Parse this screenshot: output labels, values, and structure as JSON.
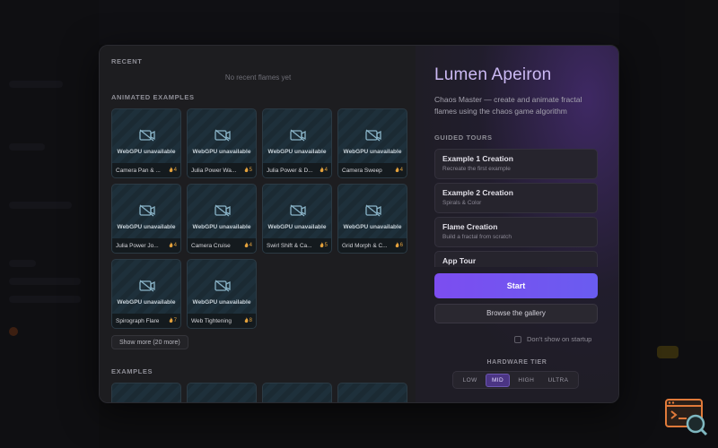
{
  "recent": {
    "label": "RECENT",
    "empty_text": "No recent flames yet"
  },
  "animated_examples": {
    "label": "ANIMATED EXAMPLES",
    "unavailable_text": "WebGPU unavailable",
    "items": [
      {
        "name": "Camera Pan & ...",
        "count": "4"
      },
      {
        "name": "Julia Power Wa...",
        "count": "5"
      },
      {
        "name": "Julia Power & D...",
        "count": "4"
      },
      {
        "name": "Camera Sweep",
        "count": "4"
      },
      {
        "name": "Julia Power Jo...",
        "count": "4"
      },
      {
        "name": "Camera Cruise",
        "count": "4"
      },
      {
        "name": "Swirl Shift & Ca...",
        "count": "5"
      },
      {
        "name": "Grid Morph & C...",
        "count": "6"
      },
      {
        "name": "Spirograph Flare",
        "count": "7"
      },
      {
        "name": "Web Tightening",
        "count": "8"
      }
    ],
    "show_more_label": "Show more (20 more)"
  },
  "examples": {
    "label": "EXAMPLES"
  },
  "app": {
    "title": "Lumen Apeiron",
    "description": "Chaos Master — create and animate fractal flames using the chaos game algorithm"
  },
  "guided_tours": {
    "label": "GUIDED TOURS",
    "items": [
      {
        "title": "Example 1 Creation",
        "subtitle": "Recreate the first example"
      },
      {
        "title": "Example 2 Creation",
        "subtitle": "Spirals & Color"
      },
      {
        "title": "Flame Creation",
        "subtitle": "Build a fractal from scratch"
      },
      {
        "title": "App Tour",
        "subtitle": ""
      }
    ]
  },
  "actions": {
    "start_label": "Start",
    "gallery_label": "Browse the gallery",
    "dont_show_label": "Don't show on startup"
  },
  "hardware_tier": {
    "label": "HARDWARE TIER",
    "options": [
      "LOW",
      "MID",
      "HIGH",
      "ULTRA"
    ],
    "selected": "MID"
  },
  "colors": {
    "accent": "#7c4df0",
    "badge": "#e3a13c"
  }
}
